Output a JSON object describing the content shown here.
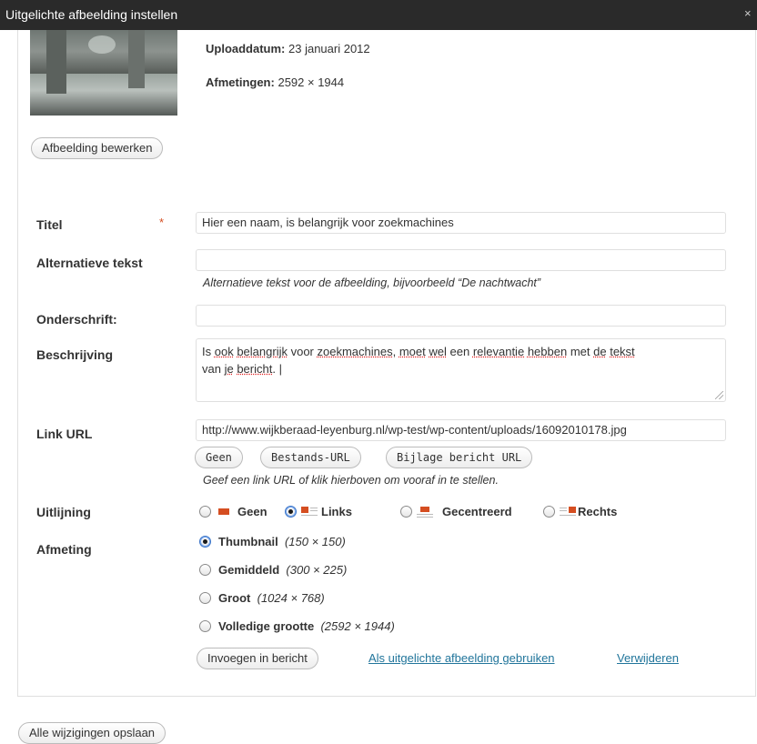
{
  "header": {
    "title": "Uitgelichte afbeelding instellen",
    "close_label": "×"
  },
  "media": {
    "upload_label": "Uploaddatum:",
    "upload_value": "23 januari 2012",
    "dims_label": "Afmetingen:",
    "dims_value": "2592 × 1944",
    "edit_button": "Afbeelding bewerken"
  },
  "form": {
    "title": {
      "label": "Titel",
      "required": "*",
      "value": "Hier een naam, is belangrijk voor zoekmachines"
    },
    "alt": {
      "label": "Alternatieve tekst",
      "value": "",
      "help": "Alternatieve tekst voor de afbeelding, bijvoorbeeld “De nachtwacht”"
    },
    "caption": {
      "label": "Onderschrift:",
      "value": ""
    },
    "description": {
      "label": "Beschrijving",
      "line1_parts": [
        "Is ",
        "ook",
        " ",
        "belangrijk",
        " voor ",
        "zoekmachines",
        ", ",
        "moet",
        " ",
        "wel",
        " een ",
        "relevantie",
        " ",
        "hebben",
        " met ",
        "de",
        " ",
        "tekst"
      ],
      "line2_parts": [
        "van ",
        "je",
        " ",
        "bericht",
        ". |"
      ]
    },
    "link": {
      "label": "Link URL",
      "value": "http://www.wijkberaad-leyenburg.nl/wp-test/wp-content/uploads/16092010178.jpg",
      "buttons": [
        "Geen",
        "Bestands-URL",
        "Bijlage bericht URL"
      ],
      "help": "Geef een link URL of klik hierboven om vooraf in te stellen."
    },
    "align": {
      "label": "Uitlijning",
      "options": [
        "Geen",
        "Links",
        "Gecentreerd",
        "Rechts"
      ],
      "selected": "Links"
    },
    "size": {
      "label": "Afmeting",
      "options": [
        {
          "name": "Thumbnail",
          "dims": "(150 × 150)"
        },
        {
          "name": "Gemiddeld",
          "dims": "(300 × 225)"
        },
        {
          "name": "Groot",
          "dims": "(1024 × 768)"
        },
        {
          "name": "Volledige grootte",
          "dims": "(2592 × 1944)"
        }
      ],
      "selected": "Thumbnail"
    }
  },
  "actions": {
    "insert_button": "Invoegen in bericht",
    "featured_link": "Als uitgelichte afbeelding gebruiken",
    "delete_link": "Verwijderen"
  },
  "footer": {
    "save_all_button": "Alle wijzigingen opslaan"
  },
  "colors": {
    "accent": "#d54e21",
    "link": "#21759b",
    "titlebar": "#2a2a2a"
  }
}
